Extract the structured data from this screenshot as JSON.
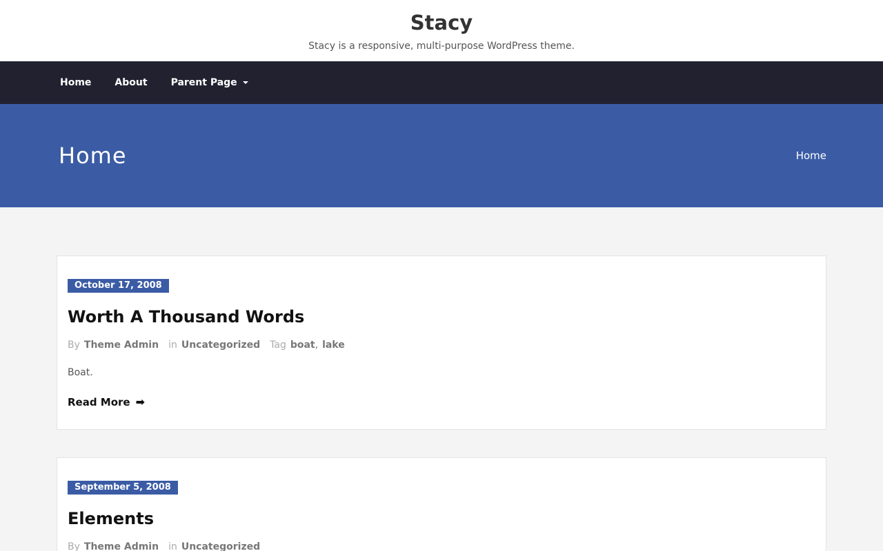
{
  "site": {
    "title": "Stacy",
    "description": "Stacy is a responsive, multi-purpose WordPress theme."
  },
  "nav": {
    "items": [
      {
        "label": "Home"
      },
      {
        "label": "About"
      },
      {
        "label": "Parent Page"
      }
    ]
  },
  "hero": {
    "title": "Home",
    "breadcrumb": "Home"
  },
  "meta_labels": {
    "by": "By",
    "in": "in",
    "tag": "Tag",
    "read_more": "Read More",
    "comma": ","
  },
  "posts": [
    {
      "date": "October 17, 2008",
      "title": "Worth A Thousand Words",
      "author": "Theme Admin",
      "category": "Uncategorized",
      "tags": [
        "boat",
        "lake"
      ],
      "excerpt": "Boat."
    },
    {
      "date": "September 5, 2008",
      "title": "Elements",
      "author": "Theme Admin",
      "category": "Uncategorized"
    }
  ],
  "colors": {
    "accent": "#3b5ca5",
    "nav_bg": "#212130"
  }
}
